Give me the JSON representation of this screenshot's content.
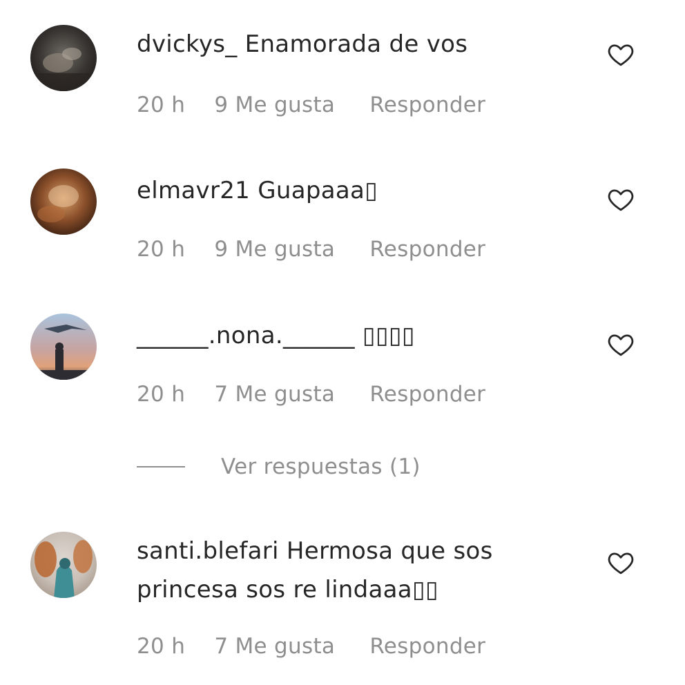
{
  "comments": [
    {
      "username": "dvickys_",
      "text": "Enamorada de vos",
      "time": "20 h",
      "likes": "9 Me gusta",
      "reply": "Responder"
    },
    {
      "username": "elmavr21",
      "text": "Guapaaa▯",
      "time": "20 h",
      "likes": "9 Me gusta",
      "reply": "Responder"
    },
    {
      "username": "______.nona.______",
      "text": "▯▯▯▯",
      "time": "20 h",
      "likes": "7 Me gusta",
      "reply": "Responder",
      "view_replies": "Ver respuestas (1)"
    },
    {
      "username": "santi.blefari",
      "text": "Hermosa que sos princesa sos re lindaaa▯▯",
      "time": "20 h",
      "likes": "7 Me gusta",
      "reply": "Responder"
    }
  ],
  "icons": {
    "like": "heart-outline-icon"
  },
  "colors": {
    "text": "#262626",
    "meta": "#8e8e8e"
  }
}
